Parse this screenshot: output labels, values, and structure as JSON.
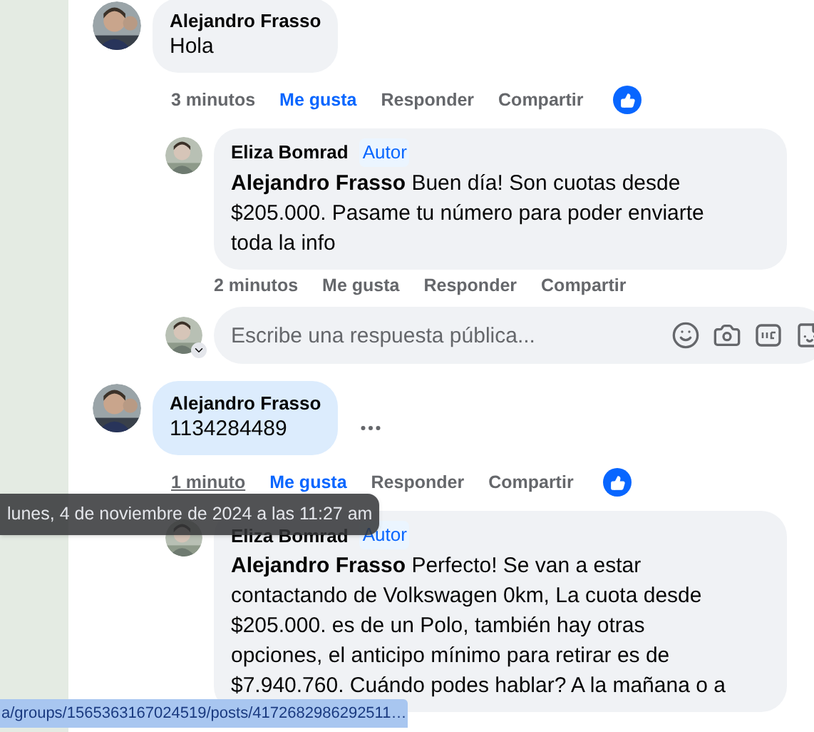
{
  "comments": [
    {
      "author": "Alejandro Frasso",
      "text": "Hola",
      "highlighted": false,
      "time": "3 minutos",
      "time_hovered": false,
      "like": "Me gusta",
      "liked": true,
      "reply": "Responder",
      "share": "Compartir",
      "reaction": true,
      "replies": [
        {
          "author": "Eliza Bomrad",
          "badge": "Autor",
          "text": "**Alejandro Frasso** Buen día! Son cuotas desde $205.000. Pasame tu número para poder enviarte toda la info",
          "time": "2 minutos",
          "like": "Me gusta",
          "liked": false,
          "reply": "Responder",
          "share": "Compartir"
        }
      ],
      "reply_box": {
        "placeholder": "Escribe una respuesta pública..."
      }
    },
    {
      "author": "Alejandro Frasso",
      "text": "1134284489",
      "highlighted": true,
      "show_menu": true,
      "time": "1 minuto",
      "time_hovered": true,
      "like": "Me gusta",
      "liked": true,
      "reply": "Responder",
      "share": "Compartir",
      "reaction": true,
      "replies": [
        {
          "author": "Eliza Bomrad",
          "badge": "Autor",
          "text": "**Alejandro Frasso** Perfecto! Se van a estar contactando de Volkswagen 0km, La cuota desde $205.000. es de un Polo, también hay otras opciones, el anticipo mínimo para retirar es de $7.940.760. Cuándo podes hablar? A la mañana o a"
        }
      ]
    }
  ],
  "tooltip": "lunes, 4 de noviembre de 2024 a las 11:27 am",
  "status_url": "a/groups/1565363167024519/posts/4172682986292511…"
}
